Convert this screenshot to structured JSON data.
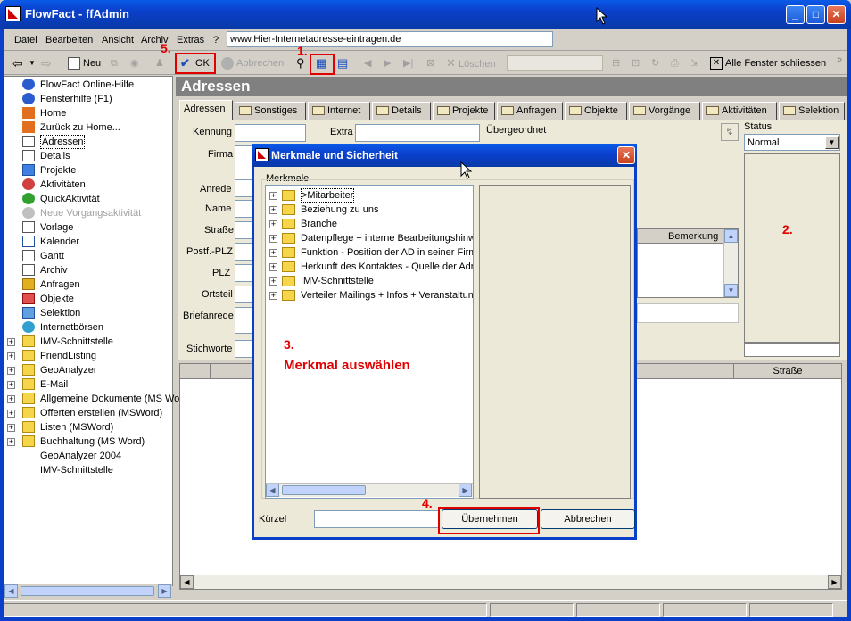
{
  "window": {
    "title": "FlowFact - ffAdmin"
  },
  "menu": {
    "items": [
      "Datei",
      "Bearbeiten",
      "Ansicht",
      "Archiv",
      "Extras",
      "?"
    ],
    "url": "www.Hier-Internetadresse-eintragen.de"
  },
  "toolbar": {
    "neu": "Neu",
    "ok": "OK",
    "abbrechen": "Abbrechen",
    "loeschen": "Löschen",
    "alle_fenster": "Alle Fenster schliessen"
  },
  "annotations": {
    "n1": "1.",
    "n2": "2.",
    "n3": "3.",
    "n3_text": "Merkmal auswählen",
    "n4": "4.",
    "n5": "5."
  },
  "tree": {
    "items": [
      {
        "label": "FlowFact Online-Hilfe",
        "icon": "help-icon",
        "plus": false
      },
      {
        "label": "Fensterhilfe (F1)",
        "icon": "help-icon",
        "plus": false
      },
      {
        "label": "Home",
        "icon": "home-icon",
        "plus": false
      },
      {
        "label": "Zurück zu Home...",
        "icon": "home-icon",
        "plus": false
      },
      {
        "label": "Adressen",
        "icon": "address-card-icon",
        "plus": false
      },
      {
        "label": "Details",
        "icon": "document-icon",
        "plus": false
      },
      {
        "label": "Projekte",
        "icon": "projects-icon",
        "plus": false
      },
      {
        "label": "Aktivitäten",
        "icon": "activity-icon",
        "plus": false
      },
      {
        "label": "QuickAktivität",
        "icon": "quick-activity-icon",
        "plus": false
      },
      {
        "label": "Neue Vorgangsaktivität",
        "icon": "new-activity-icon",
        "plus": false,
        "disabled": true
      },
      {
        "label": "Vorlage",
        "icon": "template-icon",
        "plus": false
      },
      {
        "label": "Kalender",
        "icon": "calendar-icon",
        "plus": false
      },
      {
        "label": "Gantt",
        "icon": "gantt-icon",
        "plus": false
      },
      {
        "label": "Archiv",
        "icon": "archive-icon",
        "plus": false
      },
      {
        "label": "Anfragen",
        "icon": "request-icon",
        "plus": false
      },
      {
        "label": "Objekte",
        "icon": "objects-icon",
        "plus": false
      },
      {
        "label": "Selektion",
        "icon": "selection-icon",
        "plus": false
      },
      {
        "label": "Internetbörsen",
        "icon": "internet-icon",
        "plus": false
      },
      {
        "label": "IMV-Schnittstelle",
        "icon": "folder-icon",
        "plus": true
      },
      {
        "label": "FriendListing",
        "icon": "folder-icon",
        "plus": true
      },
      {
        "label": "GeoAnalyzer",
        "icon": "folder-icon",
        "plus": true
      },
      {
        "label": "E-Mail",
        "icon": "folder-icon",
        "plus": true
      },
      {
        "label": "Allgemeine Dokumente (MS Wo",
        "icon": "folder-icon",
        "plus": true
      },
      {
        "label": "Offerten erstellen (MSWord)",
        "icon": "folder-icon",
        "plus": true
      },
      {
        "label": "Listen (MSWord)",
        "icon": "folder-icon",
        "plus": true
      },
      {
        "label": "Buchhaltung (MS Word)",
        "icon": "folder-icon",
        "plus": true
      },
      {
        "label": "GeoAnalyzer 2004",
        "icon": "none",
        "plus": false
      },
      {
        "label": "IMV-Schnittstelle",
        "icon": "none",
        "plus": false
      }
    ]
  },
  "main": {
    "header": "Adressen",
    "tabs": [
      "Adressen",
      "Sonstiges",
      "Internet",
      "Details",
      "Projekte",
      "Anfragen",
      "Objekte",
      "Vorgänge",
      "Aktivitäten",
      "Selektion"
    ],
    "labels": {
      "kennung": "Kennung",
      "extra": "Extra",
      "uebergeordnet": "Übergeordnet",
      "firma": "Firma",
      "anrede": "Anrede",
      "name": "Name",
      "strasse": "Straße",
      "postf_plz": "Postf.-PLZ",
      "plz": "PLZ",
      "ortsteil": "Ortsteil",
      "briefanrede": "Briefanrede",
      "stichworte": "Stichworte",
      "status": "Status",
      "status_value": "Normal",
      "bemerkung": "Bemerkung",
      "grid_strasse": "Straße"
    }
  },
  "dialog": {
    "title": "Merkmale und Sicherheit",
    "group": "Merkmale",
    "items": [
      ">Mitarbeiter",
      "Beziehung zu uns",
      "Branche",
      "Datenpflege + interne Bearbeitungshinwe",
      "Funktion - Position der AD in seiner Firma",
      "Herkunft des Kontaktes - Quelle der Adre",
      "IMV-Schnittstelle",
      "Verteiler Mailings + Infos + Veranstaltung"
    ],
    "kuerzel_label": "Kürzel",
    "uebernehmen": "Übernehmen",
    "abbrechen": "Abbrechen"
  }
}
